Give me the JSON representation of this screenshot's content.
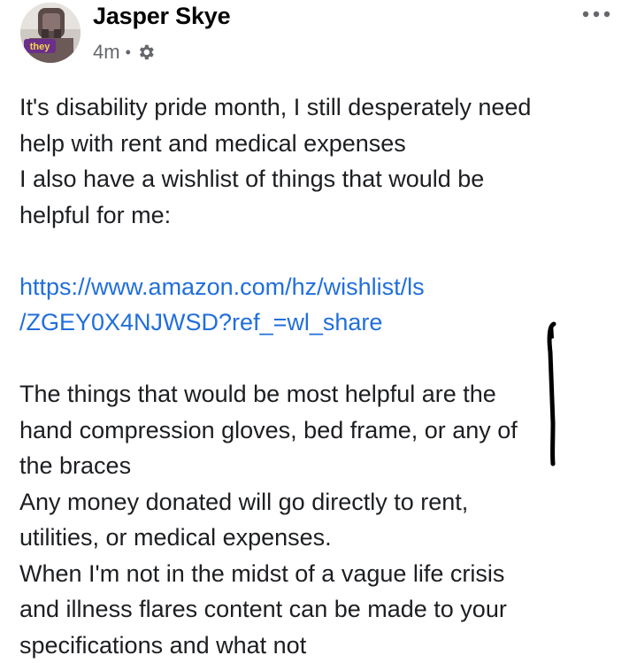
{
  "post": {
    "author": "Jasper Skye",
    "avatar_badge": "they",
    "timestamp": "4m",
    "separator": "•",
    "audience_icon": "gear-icon",
    "menu_icon": "more-dots-icon",
    "body": {
      "intro": "It's disability pride month, I still desperately need\nhelp with rent and medical expenses\nI also have a wishlist of things that would be\nhelpful for me:",
      "link_line1": "https://www.amazon.com/hz/wishlist/ls",
      "link_line2": "/ZGEY0X4NJWSD?ref_=wl_share",
      "paragraph2": "The things that would be most helpful are the\nhand compression gloves, bed frame, or any of\nthe braces\nAny money donated will go directly to rent,\nutilities, or medical expenses.\nWhen I'm not in the midst of a vague life crisis\nand illness flares content can be made to your\nspecifications and what not"
    }
  },
  "colors": {
    "link": "#216fdb",
    "text": "#1c1e21",
    "meta": "#65676b",
    "marker": "#000000"
  }
}
